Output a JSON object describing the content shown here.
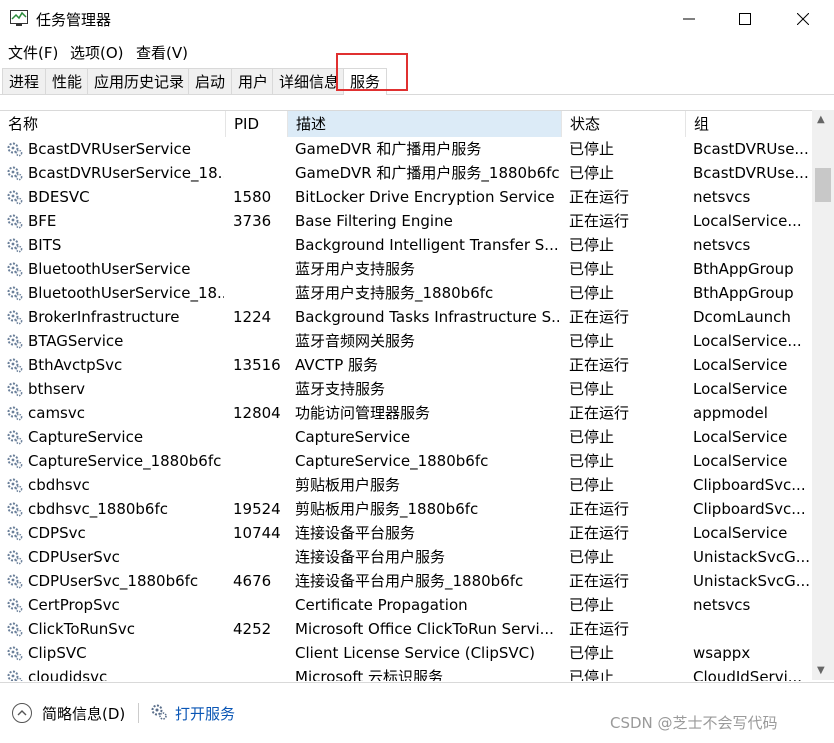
{
  "window": {
    "title": "任务管理器"
  },
  "menu": [
    "文件(F)",
    "选项(O)",
    "查看(V)"
  ],
  "tabs": [
    "进程",
    "性能",
    "应用历史记录",
    "启动",
    "用户",
    "详细信息",
    "服务"
  ],
  "active_tab": "服务",
  "columns": [
    "名称",
    "PID",
    "描述",
    "状态",
    "组"
  ],
  "sorted_column": "描述",
  "rows": [
    {
      "name": "BcastDVRUserService",
      "pid": "",
      "desc": "GameDVR 和广播用户服务",
      "status": "已停止",
      "group": "BcastDVRUse..."
    },
    {
      "name": "BcastDVRUserService_18...",
      "pid": "",
      "desc": "GameDVR 和广播用户服务_1880b6fc",
      "status": "已停止",
      "group": "BcastDVRUse..."
    },
    {
      "name": "BDESVC",
      "pid": "1580",
      "desc": "BitLocker Drive Encryption Service",
      "status": "正在运行",
      "group": "netsvcs"
    },
    {
      "name": "BFE",
      "pid": "3736",
      "desc": "Base Filtering Engine",
      "status": "正在运行",
      "group": "LocalService..."
    },
    {
      "name": "BITS",
      "pid": "",
      "desc": "Background Intelligent Transfer S...",
      "status": "已停止",
      "group": "netsvcs"
    },
    {
      "name": "BluetoothUserService",
      "pid": "",
      "desc": "蓝牙用户支持服务",
      "status": "已停止",
      "group": "BthAppGroup"
    },
    {
      "name": "BluetoothUserService_18...",
      "pid": "",
      "desc": "蓝牙用户支持服务_1880b6fc",
      "status": "已停止",
      "group": "BthAppGroup"
    },
    {
      "name": "BrokerInfrastructure",
      "pid": "1224",
      "desc": "Background Tasks Infrastructure S...",
      "status": "正在运行",
      "group": "DcomLaunch"
    },
    {
      "name": "BTAGService",
      "pid": "",
      "desc": "蓝牙音频网关服务",
      "status": "已停止",
      "group": "LocalService..."
    },
    {
      "name": "BthAvctpSvc",
      "pid": "13516",
      "desc": "AVCTP 服务",
      "status": "正在运行",
      "group": "LocalService"
    },
    {
      "name": "bthserv",
      "pid": "",
      "desc": "蓝牙支持服务",
      "status": "已停止",
      "group": "LocalService"
    },
    {
      "name": "camsvc",
      "pid": "12804",
      "desc": "功能访问管理器服务",
      "status": "正在运行",
      "group": "appmodel"
    },
    {
      "name": "CaptureService",
      "pid": "",
      "desc": "CaptureService",
      "status": "已停止",
      "group": "LocalService"
    },
    {
      "name": "CaptureService_1880b6fc",
      "pid": "",
      "desc": "CaptureService_1880b6fc",
      "status": "已停止",
      "group": "LocalService"
    },
    {
      "name": "cbdhsvc",
      "pid": "",
      "desc": "剪贴板用户服务",
      "status": "已停止",
      "group": "ClipboardSvc..."
    },
    {
      "name": "cbdhsvc_1880b6fc",
      "pid": "19524",
      "desc": "剪贴板用户服务_1880b6fc",
      "status": "正在运行",
      "group": "ClipboardSvc..."
    },
    {
      "name": "CDPSvc",
      "pid": "10744",
      "desc": "连接设备平台服务",
      "status": "正在运行",
      "group": "LocalService"
    },
    {
      "name": "CDPUserSvc",
      "pid": "",
      "desc": "连接设备平台用户服务",
      "status": "已停止",
      "group": "UnistackSvcG..."
    },
    {
      "name": "CDPUserSvc_1880b6fc",
      "pid": "4676",
      "desc": "连接设备平台用户服务_1880b6fc",
      "status": "正在运行",
      "group": "UnistackSvcG..."
    },
    {
      "name": "CertPropSvc",
      "pid": "",
      "desc": "Certificate Propagation",
      "status": "已停止",
      "group": "netsvcs"
    },
    {
      "name": "ClickToRunSvc",
      "pid": "4252",
      "desc": "Microsoft Office ClickToRun Servi...",
      "status": "正在运行",
      "group": ""
    },
    {
      "name": "ClipSVC",
      "pid": "",
      "desc": "Client License Service (ClipSVC)",
      "status": "已停止",
      "group": "wsappx"
    },
    {
      "name": "cloudidsvc",
      "pid": "",
      "desc": "Microsoft 云标识服务",
      "status": "已停止",
      "group": "CloudIdServi..."
    }
  ],
  "footer": {
    "fewer_details": "简略信息(D)",
    "open_services": "打开服务"
  },
  "watermark": "CSDN @芝士不会写代码",
  "colors": {
    "highlight_box": "#e03030",
    "link": "#0a56b5",
    "sorted_header": "#dcebf7"
  }
}
